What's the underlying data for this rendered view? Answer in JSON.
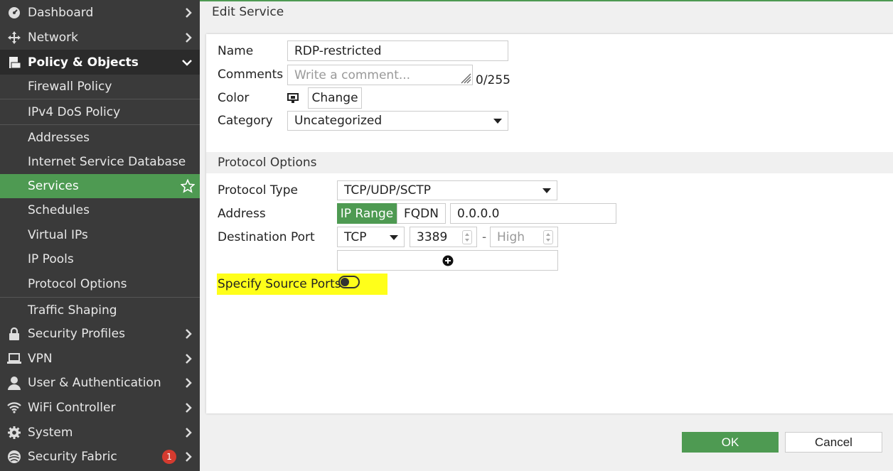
{
  "sidebar": {
    "top_items": [
      {
        "label": "Dashboard",
        "icon": "dashboard-icon"
      },
      {
        "label": "Network",
        "icon": "network-icon"
      }
    ],
    "open_section": {
      "label": "Policy & Objects",
      "icon": "policy-icon"
    },
    "sub_items": [
      {
        "label": "Firewall Policy"
      },
      {
        "label": "IPv4 DoS Policy"
      },
      {
        "label": "Addresses"
      },
      {
        "label": "Internet Service Database"
      },
      {
        "label": "Services",
        "active": true
      },
      {
        "label": "Schedules"
      },
      {
        "label": "Virtual IPs"
      },
      {
        "label": "IP Pools"
      },
      {
        "label": "Protocol Options"
      },
      {
        "label": "Traffic Shaping"
      }
    ],
    "bottom_items": [
      {
        "label": "Security Profiles",
        "icon": "lock-icon"
      },
      {
        "label": "VPN",
        "icon": "laptop-icon"
      },
      {
        "label": "User & Authentication",
        "icon": "user-icon"
      },
      {
        "label": "WiFi Controller",
        "icon": "wifi-icon"
      },
      {
        "label": "System",
        "icon": "gear-icon"
      },
      {
        "label": "Security Fabric",
        "icon": "fabric-icon",
        "badge": "1"
      }
    ]
  },
  "header": {
    "title": "Edit Service"
  },
  "form": {
    "name_label": "Name",
    "name_value": "RDP-restricted",
    "comments_label": "Comments",
    "comments_placeholder": "Write a comment...",
    "comments_count": "0/255",
    "color_label": "Color",
    "color_change_label": "Change",
    "category_label": "Category",
    "category_value": "Uncategorized"
  },
  "protocol": {
    "section_title": "Protocol Options",
    "type_label": "Protocol Type",
    "type_value": "TCP/UDP/SCTP",
    "address_label": "Address",
    "address_mode_iprange": "IP Range",
    "address_mode_fqdn": "FQDN",
    "address_value": "0.0.0.0",
    "dest_port_label": "Destination Port",
    "dest_port_protocol": "TCP",
    "dest_port_low": "3389",
    "dest_port_dash": "-",
    "dest_port_high_placeholder": "High",
    "source_ports_label": "Specify Source Ports",
    "source_ports_enabled": false
  },
  "footer": {
    "ok_label": "OK",
    "cancel_label": "Cancel"
  },
  "colors": {
    "accent": "#4e9a52",
    "sidebar_bg": "#3a3a3a",
    "highlight": "#ffff1a",
    "badge": "#d43b2f"
  }
}
